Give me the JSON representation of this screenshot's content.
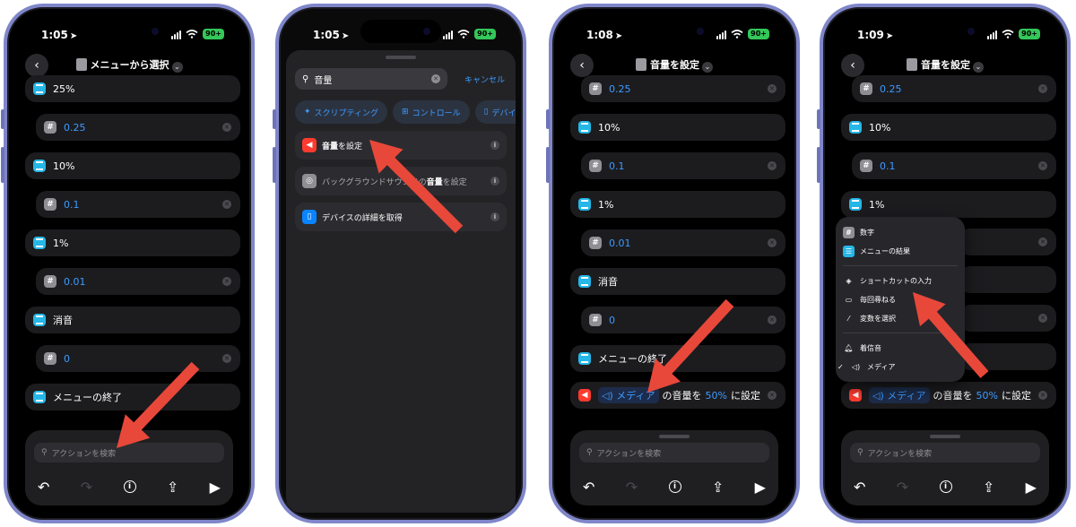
{
  "status": {
    "p1_time": "1:05",
    "p2_time": "1:05",
    "p3_time": "1:08",
    "p4_time": "1:09",
    "battery": "90+"
  },
  "phone1": {
    "title": "メニューから選択",
    "rows": [
      {
        "kind": "menu",
        "text": "25%"
      },
      {
        "kind": "num",
        "text": "0.25"
      },
      {
        "kind": "menu",
        "text": "10%"
      },
      {
        "kind": "num",
        "text": "0.1"
      },
      {
        "kind": "menu",
        "text": "1%"
      },
      {
        "kind": "num",
        "text": "0.01"
      },
      {
        "kind": "menu",
        "text": "消音"
      },
      {
        "kind": "num",
        "text": "0"
      },
      {
        "kind": "menu",
        "text": "メニューの終了"
      }
    ],
    "search_placeholder": "アクションを検索"
  },
  "phone2": {
    "search_value": "音量",
    "cancel": "キャンセル",
    "chips": [
      "スクリプティング",
      "コントロール",
      "デバイス"
    ],
    "results": [
      {
        "bold": "音量",
        "rest": "を設定"
      },
      {
        "pre": "バックグラウンドサウンドの",
        "bold": "音量",
        "rest": "を設定"
      },
      {
        "text": "デバイスの詳細を取得"
      }
    ]
  },
  "phone3": {
    "title": "音量を設定",
    "rows": [
      {
        "kind": "num",
        "text": "0.25"
      },
      {
        "kind": "menu",
        "text": "10%"
      },
      {
        "kind": "num",
        "text": "0.1"
      },
      {
        "kind": "menu",
        "text": "1%"
      },
      {
        "kind": "num",
        "text": "0.01"
      },
      {
        "kind": "menu",
        "text": "消音"
      },
      {
        "kind": "num",
        "text": "0"
      },
      {
        "kind": "menu",
        "text": "メニューの終了"
      }
    ],
    "action": {
      "token": "メディア",
      "mid": "の音量を",
      "value": "50%",
      "end": "に設定"
    },
    "search_placeholder": "アクションを検索"
  },
  "phone4": {
    "title": "音量を設定",
    "rows": [
      {
        "kind": "num",
        "text": "0.25"
      },
      {
        "kind": "menu",
        "text": "10%"
      },
      {
        "kind": "num",
        "text": "0.1"
      },
      {
        "kind": "menu",
        "text": "1%"
      }
    ],
    "action": {
      "token": "メディア",
      "mid": "の音量を",
      "value": "50%",
      "end": "に設定"
    },
    "popup": {
      "items": [
        "数字",
        "メニューの結果",
        "ショートカットの入力",
        "毎回尋ねる",
        "変数を選択",
        "着信音",
        "メディア"
      ]
    },
    "search_placeholder": "アクションを検索"
  },
  "colors": {
    "arrow": "#e8483a",
    "accent": "#3d9bff",
    "menu_icon": "#25b7e7",
    "frame": "#7f86c9"
  }
}
